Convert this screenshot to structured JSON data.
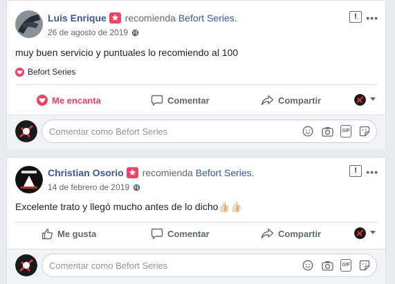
{
  "posts": [
    {
      "author": "Luis Enrique",
      "recommends": "recomienda",
      "page": "Befort Series.",
      "date": "26 de agosto de 2019",
      "text": "muy buen servicio y puntuales lo recomiendo al 100",
      "reaction_label": "Befort Series",
      "actions": {
        "like": "Me encanta",
        "comment": "Comentar",
        "share": "Compartir"
      },
      "comment_placeholder": "Comentar como Befort Series"
    },
    {
      "author": "Christian Osorio",
      "recommends": "recomienda",
      "page": "Befort Series.",
      "date": "14 de febrero de 2019",
      "text": "Excelente trato y llegó mucho antes de lo dicho👍🏻👍🏻",
      "actions": {
        "like": "Me gusta",
        "comment": "Comentar",
        "share": "Compartir"
      },
      "comment_placeholder": "Comentar como Befort Series"
    }
  ],
  "colors": {
    "accent_love": "#f33e58",
    "link": "#385898",
    "recommend_badge": "#f3425f"
  }
}
